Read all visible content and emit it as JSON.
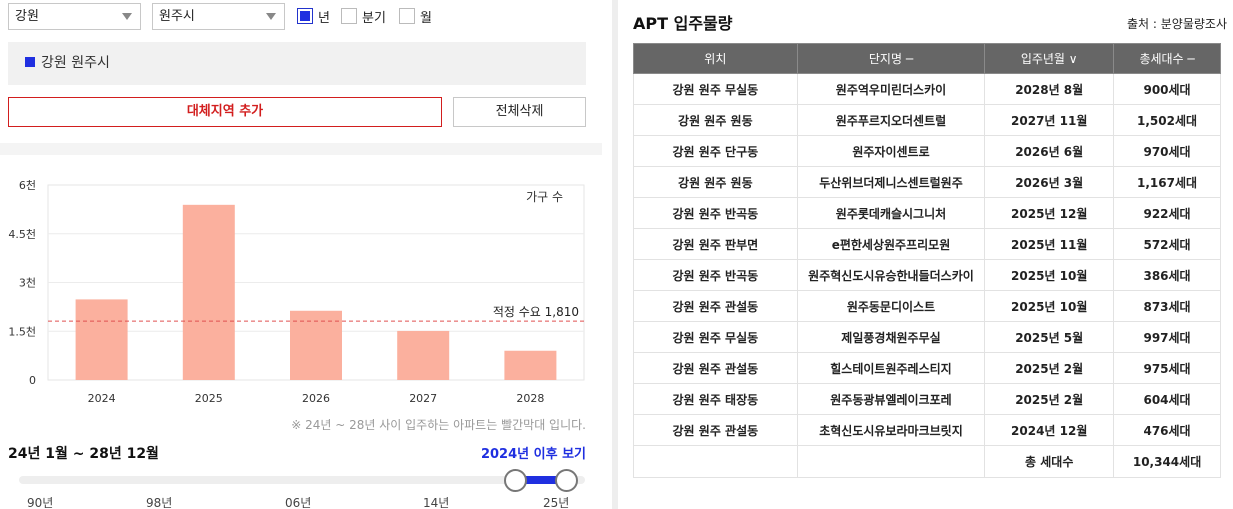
{
  "filters": {
    "province": "강원",
    "city": "원주시",
    "period_options": [
      {
        "label": "년",
        "checked": true
      },
      {
        "label": "분기",
        "checked": false
      },
      {
        "label": "월",
        "checked": false
      }
    ]
  },
  "region_tag": "강원 원주시",
  "buttons": {
    "add_region": "대체지역 추가",
    "delete_all": "전체삭제"
  },
  "chart_data": {
    "type": "bar",
    "categories": [
      "2024",
      "2025",
      "2026",
      "2027",
      "2028"
    ],
    "values": [
      2480,
      5390,
      2130,
      1510,
      900
    ],
    "y_ticks": [
      "0",
      "1.5천",
      "3천",
      "4.5천",
      "6천"
    ],
    "ylim": [
      0,
      6000
    ],
    "legend_label": "가구 수",
    "reference_value": 1810,
    "reference_label": "적정 수요 1,810",
    "bar_color": "#fbb09e",
    "reference_color": "#e05050"
  },
  "chart_note": "※ 24년 ~ 28년 사이 입주하는 아파트는 빨간막대 입니다.",
  "range": {
    "title": "24년 1월 ~ 28년 12월",
    "link": "2024년 이후 보기",
    "ticks": [
      "90년",
      "98년",
      "06년",
      "14년",
      "25년"
    ],
    "low_fraction": 0.878,
    "high_fraction": 0.968
  },
  "apt": {
    "title": "APT 입주물량",
    "source": "출처 : 분양물량조사",
    "headers": [
      "위치",
      "단지명 ─",
      "입주년월 ∨",
      "총세대수 ─"
    ],
    "rows": [
      [
        "강원 원주 무실동",
        "원주역우미린더스카이",
        "2028년 8월",
        "900세대"
      ],
      [
        "강원 원주 원동",
        "원주푸르지오더센트럴",
        "2027년 11월",
        "1,502세대"
      ],
      [
        "강원 원주 단구동",
        "원주자이센트로",
        "2026년 6월",
        "970세대"
      ],
      [
        "강원 원주 원동",
        "두산위브더제니스센트럴원주",
        "2026년 3월",
        "1,167세대"
      ],
      [
        "강원 원주 반곡동",
        "원주롯데캐슬시그니처",
        "2025년 12월",
        "922세대"
      ],
      [
        "강원 원주 판부면",
        "e편한세상원주프리모원",
        "2025년 11월",
        "572세대"
      ],
      [
        "강원 원주 반곡동",
        "원주혁신도시유승한내들더스카이",
        "2025년 10월",
        "386세대"
      ],
      [
        "강원 원주 관설동",
        "원주동문디이스트",
        "2025년 10월",
        "873세대"
      ],
      [
        "강원 원주 무실동",
        "제일풍경채원주무실",
        "2025년 5월",
        "997세대"
      ],
      [
        "강원 원주 관설동",
        "힐스테이트원주레스티지",
        "2025년 2월",
        "975세대"
      ],
      [
        "강원 원주 태장동",
        "원주동광뷰엘레이크포레",
        "2025년 2월",
        "604세대"
      ],
      [
        "강원 원주 관설동",
        "초혁신도시유보라마크브릿지",
        "2024년 12월",
        "476세대"
      ]
    ],
    "total_label": "총 세대수",
    "total_value": "10,344세대"
  }
}
